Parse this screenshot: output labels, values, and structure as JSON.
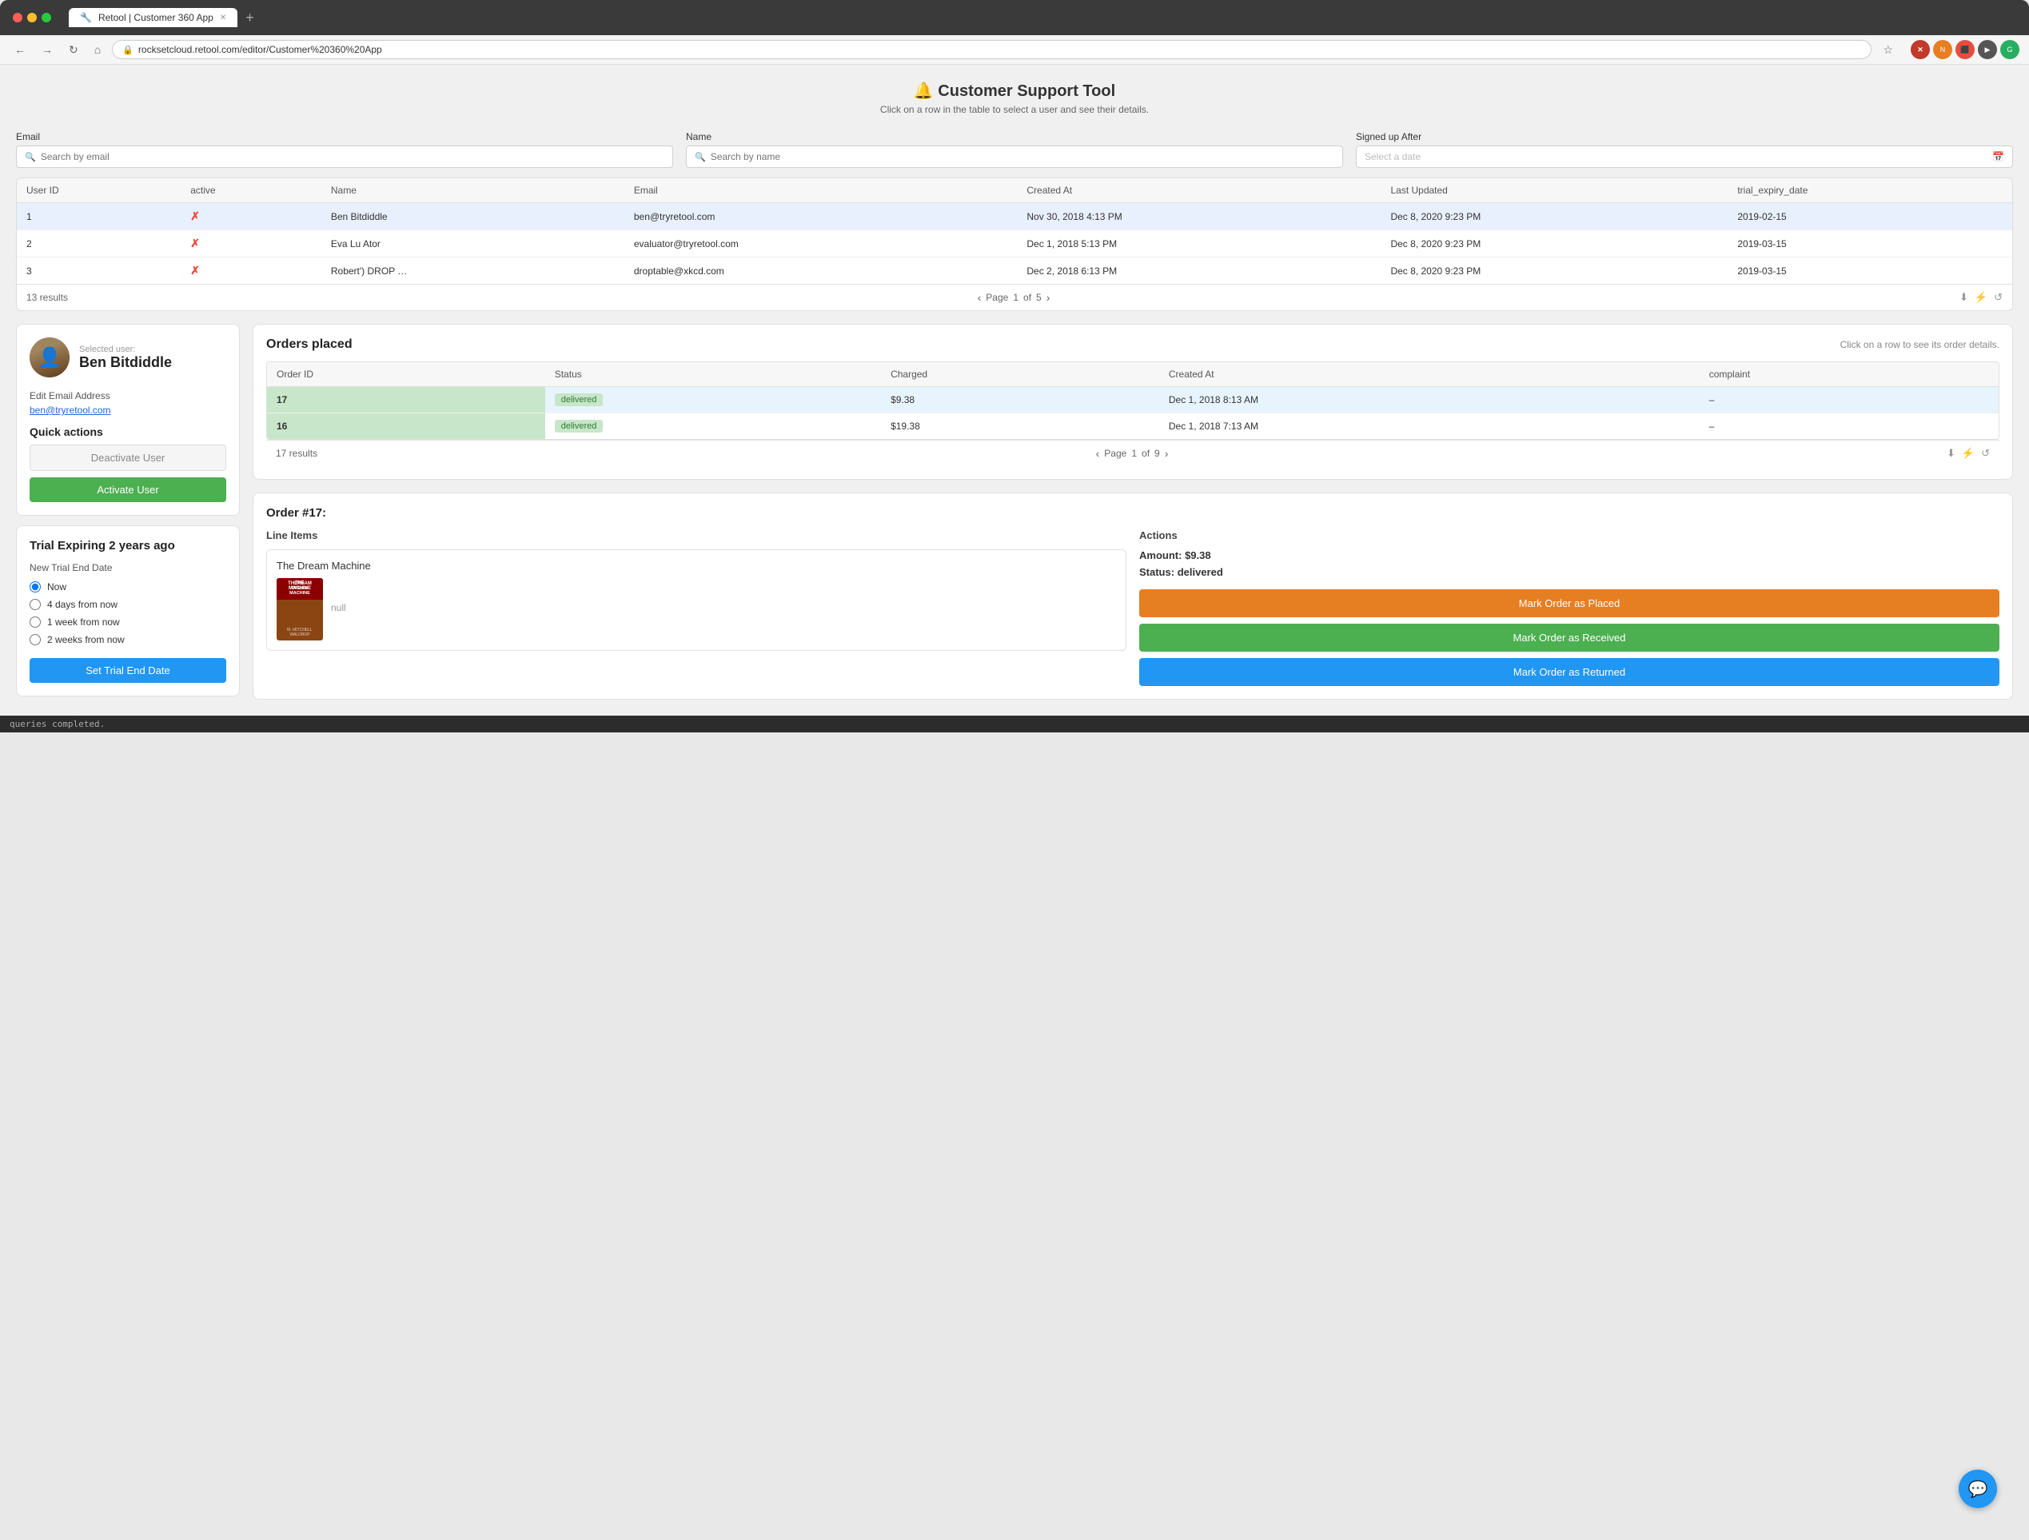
{
  "browser": {
    "tab_label": "Retool | Customer 360 App",
    "url": "rocksetcloud.retool.com/editor/Customer%20360%20App",
    "new_tab_label": "+"
  },
  "app": {
    "title": "🔔 Customer Support Tool",
    "subtitle": "Click on a row in the table to select a user and see their details."
  },
  "filters": {
    "email_label": "Email",
    "email_placeholder": "Search by email",
    "name_label": "Name",
    "name_placeholder": "Search by name",
    "date_label": "Signed up After",
    "date_placeholder": "Select a date"
  },
  "users_table": {
    "columns": [
      "User ID",
      "active",
      "Name",
      "Email",
      "Created At",
      "Last Updated",
      "trial_expiry_date"
    ],
    "rows": [
      {
        "id": "1",
        "active": "✗",
        "name": "Ben Bitdiddle",
        "email": "ben@tryretool.com",
        "created_at": "Nov 30, 2018 4:13 PM",
        "last_updated": "Dec 8, 2020 9:23 PM",
        "trial": "2019-02-15"
      },
      {
        "id": "2",
        "active": "✗",
        "name": "Eva Lu Ator",
        "email": "evaluator@tryretool.com",
        "created_at": "Dec 1, 2018 5:13 PM",
        "last_updated": "Dec 8, 2020 9:23 PM",
        "trial": "2019-03-15"
      },
      {
        "id": "3",
        "active": "✗",
        "name": "Robert') DROP …",
        "email": "droptable@xkcd.com",
        "created_at": "Dec 2, 2018 6:13 PM",
        "last_updated": "Dec 8, 2020 9:23 PM",
        "trial": "2019-03-15"
      }
    ],
    "results_count": "13 results",
    "page_label": "Page",
    "current_page": "1",
    "total_pages": "5"
  },
  "user_card": {
    "selected_label": "Selected user:",
    "user_name": "Ben Bitdiddle",
    "edit_email_label": "Edit Email Address",
    "user_email": "ben@tryretool.com",
    "quick_actions_label": "Quick actions",
    "deactivate_btn": "Deactivate User",
    "activate_btn": "Activate User"
  },
  "trial_card": {
    "title": "Trial Expiring 2 years ago",
    "end_date_label": "New Trial End Date",
    "options": [
      "Now",
      "4 days from now",
      "1 week from now",
      "2 weeks from now"
    ],
    "set_btn": "Set Trial End Date"
  },
  "orders": {
    "title": "Orders placed",
    "hint": "Click on a row to see its order details.",
    "columns": [
      "Order ID",
      "Status",
      "Charged",
      "Created At",
      "complaint"
    ],
    "rows": [
      {
        "id": "17",
        "status": "delivered",
        "charged": "$9.38",
        "created_at": "Dec 1, 2018 8:13 AM",
        "complaint": "–"
      },
      {
        "id": "16",
        "status": "delivered",
        "charged": "$19.38",
        "created_at": "Dec 1, 2018 7:13 AM",
        "complaint": "–"
      }
    ],
    "results_count": "17 results",
    "page_label": "Page",
    "current_page": "1",
    "total_pages": "9"
  },
  "order_detail": {
    "title": "Order #17:",
    "line_items_label": "Line Items",
    "actions_label": "Actions",
    "item_name": "The Dream Machine",
    "item_null": "null",
    "amount_label": "Amount:",
    "amount_value": "$9.38",
    "status_label": "Status:",
    "status_value": "delivered",
    "btn_placed": "Mark Order as Placed",
    "btn_received": "Mark Order as Received",
    "btn_returned": "Mark Order as Returned"
  },
  "status_bar": {
    "text": "queries completed."
  },
  "icons": {
    "search": "🔍",
    "calendar": "📅",
    "download": "⬇",
    "filter": "⚡",
    "refresh": "↺",
    "back": "←",
    "forward": "→",
    "reload": "↻",
    "home": "⌂",
    "lock": "🔒",
    "star": "☆",
    "chat": "💬"
  }
}
